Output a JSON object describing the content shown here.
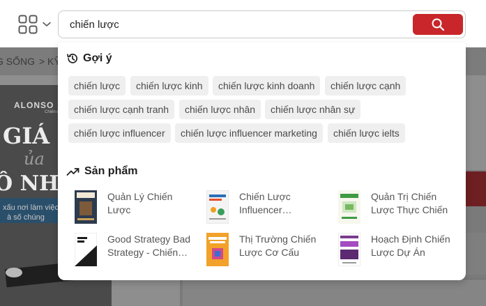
{
  "header": {
    "category_icon": "grid-icon",
    "chevron_icon": "chevron-down-icon",
    "search_value": "chiến lược",
    "search_button_icon": "search-icon",
    "accent_color": "#c8262a"
  },
  "background": {
    "breadcrumb_left": "G SỐNG",
    "breadcrumb_sep": ">",
    "breadcrumb_right": "KỸ",
    "hero_brand": "ALONSO",
    "hero_sub": "Chiến dịch",
    "hero_line1": "GIÁ",
    "hero_line2": "ủa",
    "hero_line3": "Ô NHE",
    "hero_tag1": "xấu nơi làm việc",
    "hero_tag2": "à số chúng"
  },
  "dropdown": {
    "suggest": {
      "icon": "history-icon",
      "title": "Gợi ý",
      "chips": [
        "chiến lược",
        "chiến lược kinh",
        "chiến lược kinh doanh",
        "chiến lược cạnh",
        "chiến lược cạnh tranh",
        "chiến lược nhân",
        "chiến lược nhân sự",
        "chiến lược influencer",
        "chiến lược influencer marketing",
        "chiến lược ielts"
      ]
    },
    "products": {
      "icon": "trending-up-icon",
      "title": "Sản phẩm",
      "items": [
        {
          "title": "Quản Lý Chiến Lược"
        },
        {
          "title": "Chiến Lược Influencer…"
        },
        {
          "title": "Quản Trị Chiến Lược Thực Chiến"
        },
        {
          "title": "Good Strategy Bad Strategy - Chiến…"
        },
        {
          "title": "Thị Trường Chiến Lược Cơ Cấu"
        },
        {
          "title": "Hoạch Định Chiến Lược Dự Án"
        }
      ]
    }
  }
}
